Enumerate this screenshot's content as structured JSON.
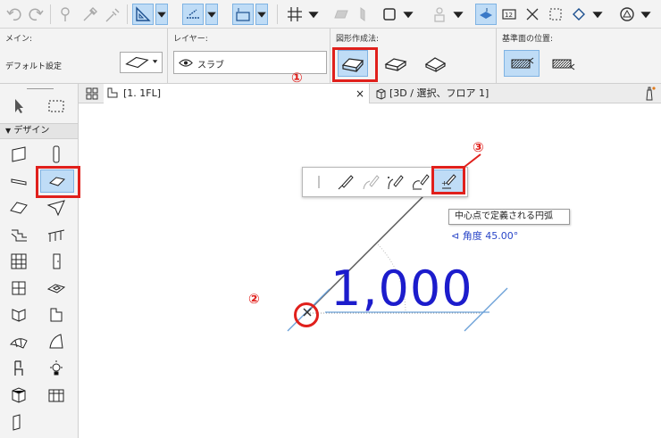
{
  "infobox": {
    "main_label": "メイン:",
    "main_value": "デフォルト設定",
    "layer_label": "レイヤー:",
    "layer_value": "スラブ",
    "geometry_label": "図形作成法:",
    "reference_label": "基準面の位置:"
  },
  "toolbox": {
    "design_label": "デザイン"
  },
  "tabs": {
    "floor_tab": "[1. 1FL]",
    "close_glyph": "×",
    "view3d_tab": "[3D / 選択、フロア 1]"
  },
  "canvas": {
    "tooltip": "中心点で定義される円弧",
    "angle_label": "角度",
    "angle_value": "45.00°",
    "dimension": "1,000",
    "marker1": "①",
    "marker2": "②",
    "marker3": "③"
  },
  "colors": {
    "highlight": "#e0201c",
    "dimension": "#1c1ccc",
    "active_bg": "#bfdcf6"
  }
}
